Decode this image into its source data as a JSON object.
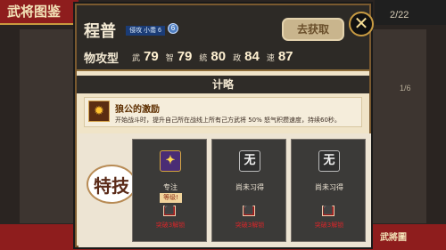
{
  "background": {
    "left_title": "武将图鉴",
    "page_counter": "2/22",
    "inner_counter": "1/6",
    "bottom_mark": "武將圖"
  },
  "general": {
    "name": "程普",
    "rank_text": "侵攻 小喬 6",
    "orb_label": "6",
    "type": "物攻型",
    "stats": [
      {
        "label": "武",
        "value": "79"
      },
      {
        "label": "智",
        "value": "79"
      },
      {
        "label": "統",
        "value": "80"
      },
      {
        "label": "政",
        "value": "84"
      },
      {
        "label": "速",
        "value": "87"
      }
    ]
  },
  "buttons": {
    "get_label": "去获取",
    "close_label": "✕"
  },
  "section": {
    "tactics_label": "计略"
  },
  "skill": {
    "icon": "✹",
    "title": "狼公的激励",
    "description": "开始战斗时，提升自己所在战线上所有己方武将 50% 怒气积攒速度，持续60秒。"
  },
  "special": {
    "tag": "特技",
    "slots": [
      {
        "icon": "✦",
        "name": "专注",
        "upgrade": "等级!",
        "lock": "⬛",
        "unlock": "突破3解锁"
      },
      {
        "icon": "无",
        "name": "尚未习得",
        "upgrade": "",
        "lock": "⬛",
        "unlock": "突破3解锁"
      },
      {
        "icon": "无",
        "name": "尚未习得",
        "upgrade": "",
        "lock": "⬛",
        "unlock": "突破3解锁"
      }
    ]
  },
  "colors": {
    "accent_red": "#8e1d1d",
    "gold": "#c79a42",
    "dark": "#2d2a26"
  }
}
